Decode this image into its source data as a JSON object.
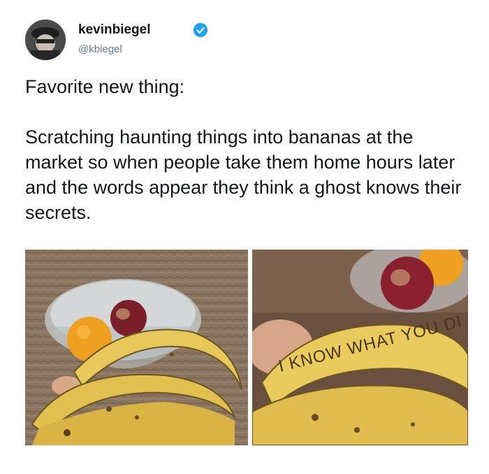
{
  "tweet": {
    "display_name": "kevinbiegel",
    "handle": "@kbiegel",
    "text": "Favorite new thing:\n\nScratching haunting things into bananas at the market so when people take them home hours later and the words appear they think a ghost knows their secrets.",
    "verified": true
  },
  "photos": {
    "right_scratched_text": "I KNOW WHAT YOU DI"
  },
  "colors": {
    "verified_badge": "#1da1f2",
    "handle_gray": "#657786",
    "text": "#14171a",
    "banana_yellow": "#e8c85a"
  }
}
